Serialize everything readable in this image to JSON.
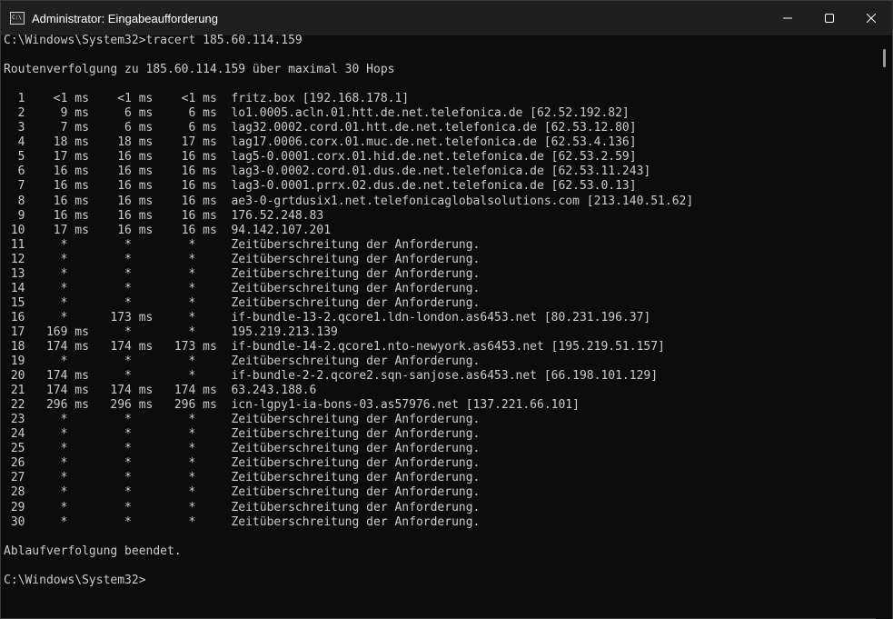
{
  "window": {
    "title": "Administrator: Eingabeaufforderung",
    "icon": "cmd-icon",
    "controls": [
      "minimize-icon",
      "maximize-icon",
      "close-icon"
    ]
  },
  "colors": {
    "background": "#0c0c0c",
    "text": "#cccccc",
    "titlebar": "#1f1f1f"
  },
  "console": {
    "lines": [
      "C:\\Windows\\System32>tracert 185.60.114.159",
      "",
      "Routenverfolgung zu 185.60.114.159 über maximal 30 Hops",
      "",
      "  1    <1 ms    <1 ms    <1 ms  fritz.box [192.168.178.1]",
      "  2     9 ms     6 ms     6 ms  lo1.0005.acln.01.htt.de.net.telefonica.de [62.52.192.82]",
      "  3     7 ms     6 ms     6 ms  lag32.0002.cord.01.htt.de.net.telefonica.de [62.53.12.80]",
      "  4    18 ms    18 ms    17 ms  lag17.0006.corx.01.muc.de.net.telefonica.de [62.53.4.136]",
      "  5    17 ms    16 ms    16 ms  lag5-0.0001.corx.01.hid.de.net.telefonica.de [62.53.2.59]",
      "  6    16 ms    16 ms    16 ms  lag3-0.0002.cord.01.dus.de.net.telefonica.de [62.53.11.243]",
      "  7    16 ms    16 ms    16 ms  lag3-0.0001.prrx.02.dus.de.net.telefonica.de [62.53.0.13]",
      "  8    16 ms    16 ms    16 ms  ae3-0-grtdusix1.net.telefonicaglobalsolutions.com [213.140.51.62]",
      "  9    16 ms    16 ms    16 ms  176.52.248.83",
      " 10    17 ms    16 ms    16 ms  94.142.107.201",
      " 11     *        *        *     Zeitüberschreitung der Anforderung.",
      " 12     *        *        *     Zeitüberschreitung der Anforderung.",
      " 13     *        *        *     Zeitüberschreitung der Anforderung.",
      " 14     *        *        *     Zeitüberschreitung der Anforderung.",
      " 15     *        *        *     Zeitüberschreitung der Anforderung.",
      " 16     *      173 ms     *     if-bundle-13-2.qcore1.ldn-london.as6453.net [80.231.196.37]",
      " 17   169 ms     *        *     195.219.213.139",
      " 18   174 ms   174 ms   173 ms  if-bundle-14-2.qcore1.nto-newyork.as6453.net [195.219.51.157]",
      " 19     *        *        *     Zeitüberschreitung der Anforderung.",
      " 20   174 ms     *        *     if-bundle-2-2.qcore2.sqn-sanjose.as6453.net [66.198.101.129]",
      " 21   174 ms   174 ms   174 ms  63.243.188.6",
      " 22   296 ms   296 ms   296 ms  icn-lgpy1-ia-bons-03.as57976.net [137.221.66.101]",
      " 23     *        *        *     Zeitüberschreitung der Anforderung.",
      " 24     *        *        *     Zeitüberschreitung der Anforderung.",
      " 25     *        *        *     Zeitüberschreitung der Anforderung.",
      " 26     *        *        *     Zeitüberschreitung der Anforderung.",
      " 27     *        *        *     Zeitüberschreitung der Anforderung.",
      " 28     *        *        *     Zeitüberschreitung der Anforderung.",
      " 29     *        *        *     Zeitüberschreitung der Anforderung.",
      " 30     *        *        *     Zeitüberschreitung der Anforderung.",
      "",
      "Ablaufverfolgung beendet.",
      "",
      "C:\\Windows\\System32>"
    ]
  }
}
